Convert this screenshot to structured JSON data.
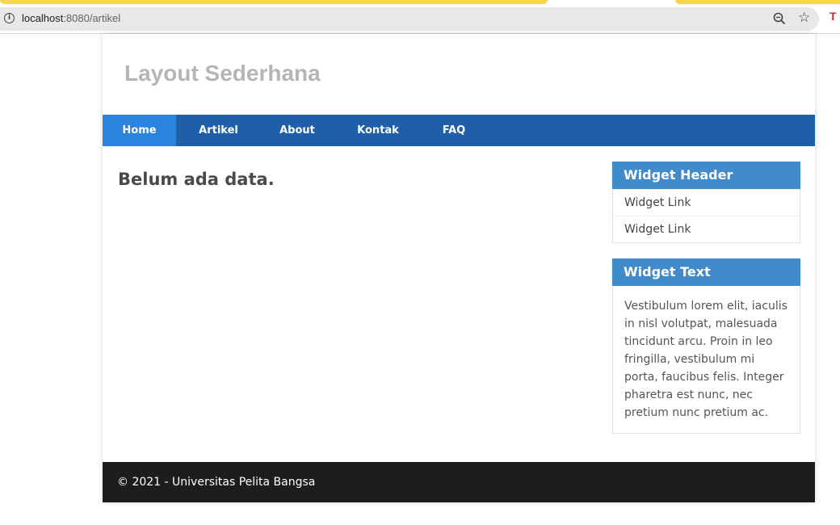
{
  "browser": {
    "url_host": "localhost",
    "url_rest": ":8080/artikel",
    "ext_label": "T"
  },
  "site": {
    "title": "Layout Sederhana"
  },
  "nav": {
    "items": [
      {
        "label": "Home"
      },
      {
        "label": "Artikel"
      },
      {
        "label": "About"
      },
      {
        "label": "Kontak"
      },
      {
        "label": "FAQ"
      }
    ]
  },
  "main": {
    "message": "Belum ada data."
  },
  "widgets": {
    "links_header": "Widget Header",
    "links": [
      {
        "label": "Widget Link"
      },
      {
        "label": "Widget Link"
      }
    ],
    "text_header": "Widget Text",
    "text_body": "Vestibulum lorem elit, iaculis in nisl volutpat, malesuada tincidunt arcu. Proin in leo fringilla, vestibulum mi porta, faucibus felis. Integer pharetra est nunc, nec pretium nunc pretium ac."
  },
  "footer": {
    "text": "© 2021 - Universitas Pelita Bangsa"
  },
  "colors": {
    "nav_bg": "#1f5faa",
    "nav_active": "#2b83e0",
    "widget_head": "#428bca",
    "footer_bg": "#1d1d1d"
  }
}
